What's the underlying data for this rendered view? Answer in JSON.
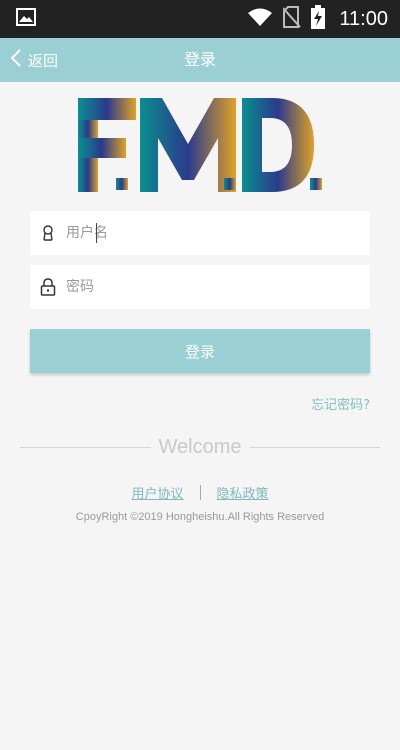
{
  "status_bar": {
    "time": "11:00",
    "icons": [
      "image-icon",
      "wifi-icon",
      "no-sim-icon",
      "battery-charging-icon"
    ]
  },
  "header": {
    "back_label": "返回",
    "title": "登录",
    "back_icon": "chevron-left-icon"
  },
  "logo": {
    "text": "F.M.D.",
    "gradient_start": "#0a8f8f",
    "gradient_mid": "#2b3a8c",
    "gradient_end": "#e0a226"
  },
  "form": {
    "username": {
      "placeholder": "用户名",
      "value": "",
      "icon": "user-icon"
    },
    "password": {
      "placeholder": "密码",
      "value": "",
      "icon": "lock-icon"
    },
    "login_label": "登录",
    "forgot_label": "忘记密码?"
  },
  "welcome": "Welcome",
  "links": {
    "agreement": "用户协议",
    "privacy": "隐私政策"
  },
  "copyright": "CpoyRight ©2019 Hongheishu.All Rights Reserved",
  "colors": {
    "accent": "#9acfd4",
    "link": "#7fb8c0",
    "status_bar": "#222222",
    "background": "#f5f5f5"
  }
}
